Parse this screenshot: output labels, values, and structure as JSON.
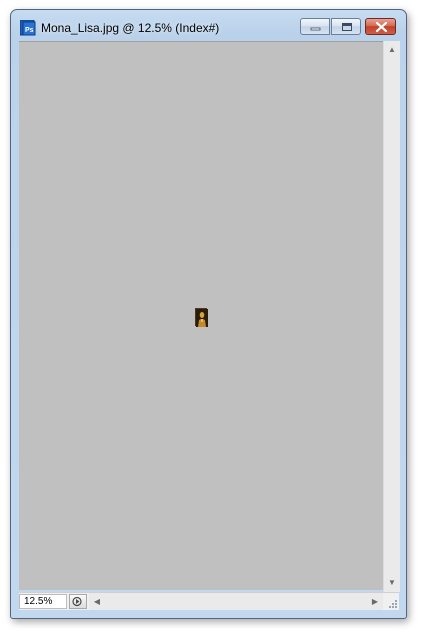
{
  "window": {
    "title": "Mona_Lisa.jpg @ 12.5% (Index#)",
    "app_icon": "photoshop-document-icon",
    "controls": {
      "minimize_icon": "minimize-icon",
      "maximize_icon": "maximize-icon",
      "close_icon": "close-icon"
    }
  },
  "canvas": {
    "background_color": "#c0c0c0",
    "image_icon": "mona-lisa-thumbnail"
  },
  "status_bar": {
    "zoom_value": "12.5%",
    "info_button_icon": "document-info-arrow-icon"
  },
  "colors": {
    "titlebar": "#b9d1ea",
    "close_button": "#c0412b",
    "canvas": "#c0c0c0"
  }
}
